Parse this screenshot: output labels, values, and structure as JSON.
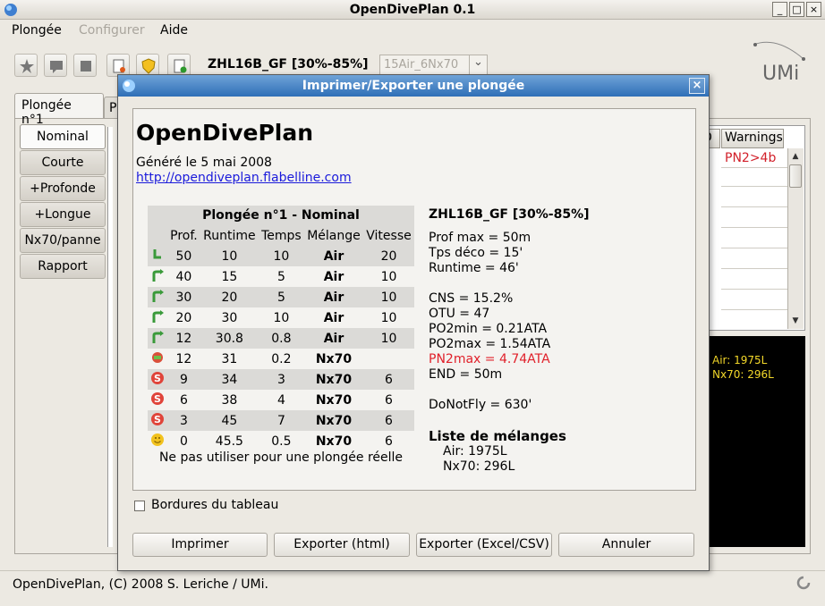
{
  "window": {
    "title": "OpenDivePlan 0.1",
    "buttons": [
      "_",
      "□",
      "×"
    ]
  },
  "menu": [
    {
      "label": "Plongée",
      "enabled": true
    },
    {
      "label": "Configurer",
      "enabled": false
    },
    {
      "label": "Aide",
      "enabled": true
    }
  ],
  "toolbar": {
    "icons": [
      "star-icon",
      "comment-icon",
      "page-icon",
      "print-icon",
      "shield-icon",
      "add-icon"
    ],
    "profile": "ZHL16B_GF [30%-85%]",
    "combo_value": "15Air_6Nx70",
    "combo_arrow": "⌄"
  },
  "logo": {
    "text": "UMi"
  },
  "tabs": {
    "main": "Plongée n°1",
    "second": "P"
  },
  "side_tabs": [
    "Nominal",
    "Courte",
    "+Profonde",
    "+Longue",
    "Nx70/panne",
    "Rapport"
  ],
  "background_table": {
    "headers": [
      "D",
      "Warnings"
    ],
    "warning": "PN2>4b",
    "scroll_up": "▲",
    "scroll_down": "▼"
  },
  "gas_summary": [
    "Air: 1975L",
    "Nx70: 296L"
  ],
  "status": "OpenDivePlan, (C) 2008 S. Leriche / UMi.",
  "colors": {
    "title_blue": "#2f6fb7",
    "warning_red": "#d2202a",
    "gas_yellow": "#f4d92a"
  },
  "dialog": {
    "title": "Imprimer/Exporter une plongée",
    "close": "×",
    "preview": {
      "heading": "OpenDivePlan",
      "generated": "Généré le 5 mai 2008",
      "link": "http://opendiveplan.flabelline.com",
      "table": {
        "caption": "Plongée n°1 - Nominal",
        "headers": [
          "Prof.",
          "Runtime",
          "Temps",
          "Mélange",
          "Vitesse"
        ],
        "rows": [
          {
            "icon": "descent",
            "prof": "50",
            "runtime": "10",
            "temps": "10",
            "melange": "Air",
            "vitesse": "20"
          },
          {
            "icon": "ascent",
            "prof": "40",
            "runtime": "15",
            "temps": "5",
            "melange": "Air",
            "vitesse": "10"
          },
          {
            "icon": "ascent",
            "prof": "30",
            "runtime": "20",
            "temps": "5",
            "melange": "Air",
            "vitesse": "10"
          },
          {
            "icon": "ascent",
            "prof": "20",
            "runtime": "30",
            "temps": "10",
            "melange": "Air",
            "vitesse": "10"
          },
          {
            "icon": "ascent",
            "prof": "12",
            "runtime": "30.8",
            "temps": "0.8",
            "melange": "Air",
            "vitesse": "10"
          },
          {
            "icon": "gas-switch",
            "prof": "12",
            "runtime": "31",
            "temps": "0.2",
            "melange": "Nx70",
            "vitesse": ""
          },
          {
            "icon": "stop",
            "prof": "9",
            "runtime": "34",
            "temps": "3",
            "melange": "Nx70",
            "vitesse": "6"
          },
          {
            "icon": "stop",
            "prof": "6",
            "runtime": "38",
            "temps": "4",
            "melange": "Nx70",
            "vitesse": "6"
          },
          {
            "icon": "stop",
            "prof": "3",
            "runtime": "45",
            "temps": "7",
            "melange": "Nx70",
            "vitesse": "6"
          },
          {
            "icon": "surface",
            "prof": "0",
            "runtime": "45.5",
            "temps": "0.5",
            "melange": "Nx70",
            "vitesse": "6"
          }
        ],
        "note": "Ne pas utiliser pour une plongée réelle"
      },
      "summary": {
        "model": "ZHL16B_GF [30%-85%]",
        "prof_max": "Prof max = 50m",
        "tps_deco": "Tps déco = 15'",
        "runtime": "Runtime = 46'",
        "cns": "CNS = 15.2%",
        "otu": "OTU = 47",
        "po2min": "PO2min = 0.21ATA",
        "po2max": "PO2max = 1.54ATA",
        "pn2max": "PN2max = 4.74ATA",
        "end": "END = 50m",
        "donotfly": "DoNotFly = 630'",
        "mixes_title": "Liste de mélanges",
        "mixes": [
          "Air: 1975L",
          "Nx70: 296L"
        ]
      }
    },
    "checkbox_label": "Bordures du tableau",
    "buttons": [
      "Imprimer",
      "Exporter (html)",
      "Exporter (Excel/CSV)",
      "Annuler"
    ]
  }
}
